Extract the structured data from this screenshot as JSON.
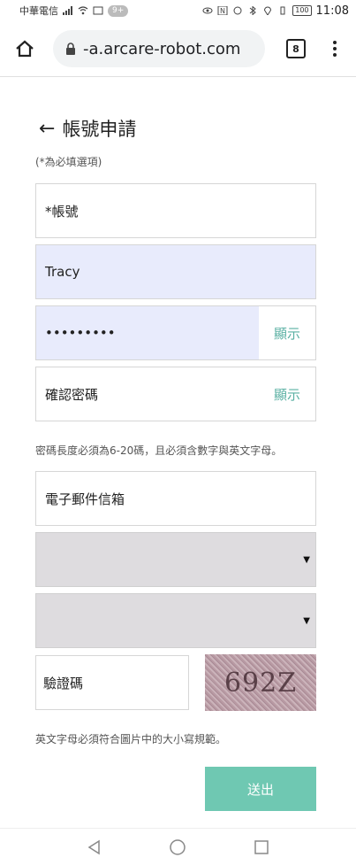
{
  "status_bar": {
    "carrier": "中華電信",
    "notification_count": "9+",
    "battery": "100",
    "time": "11:08"
  },
  "browser": {
    "url": "-a.arcare-robot.com",
    "tab_count": "8"
  },
  "page": {
    "title": "帳號申請",
    "required_note": "(*為必填選項)"
  },
  "form": {
    "account_placeholder": "*帳號",
    "name_value": "Tracy",
    "password_value": "•••••••••",
    "show_label": "顯示",
    "confirm_password_placeholder": "確認密碼",
    "password_hint": "密碼長度必須為6-20碼，且必須含數字與英文字母。",
    "email_placeholder": "電子郵件信箱",
    "captcha_placeholder": "驗證碼",
    "captcha_text": "692Z",
    "captcha_hint": "英文字母必須符合圖片中的大小寫規範。",
    "submit_label": "送出"
  },
  "colors": {
    "accent": "#6fc8b2",
    "show_text": "#5ab0a3",
    "autofill_bg": "#e8ebfc"
  }
}
